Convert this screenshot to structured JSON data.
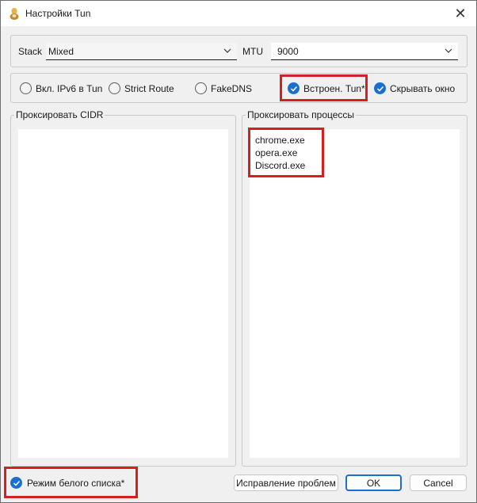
{
  "window": {
    "title": "Настройки Tun",
    "close_glyph": "✕",
    "accent_color": "#1a6fd1",
    "highlight_color": "#d42020"
  },
  "row1": {
    "stack_label": "Stack",
    "stack_value": "Mixed",
    "mtu_label": "MTU",
    "mtu_value": "9000"
  },
  "options": {
    "ipv6_label": "Вкл. IPv6 в Tun",
    "ipv6_checked": false,
    "strict_route_label": "Strict Route",
    "strict_route_checked": false,
    "fakedns_label": "FakeDNS",
    "fakedns_checked": false,
    "builtin_tun_label": "Встроен. Tun*",
    "builtin_tun_checked": true,
    "hide_window_label": "Скрывать окно",
    "hide_window_checked": true
  },
  "cidr_group": {
    "title": "Проксировать CIDR"
  },
  "process_group": {
    "title": "Проксировать процессы",
    "processes": [
      "chrome.exe",
      "opera.exe",
      "Discord.exe"
    ]
  },
  "footer": {
    "whitelist_label": "Режим белого списка*",
    "whitelist_checked": true,
    "fix_button": "Исправление проблем",
    "ok_button": "OK",
    "cancel_button": "Cancel"
  }
}
